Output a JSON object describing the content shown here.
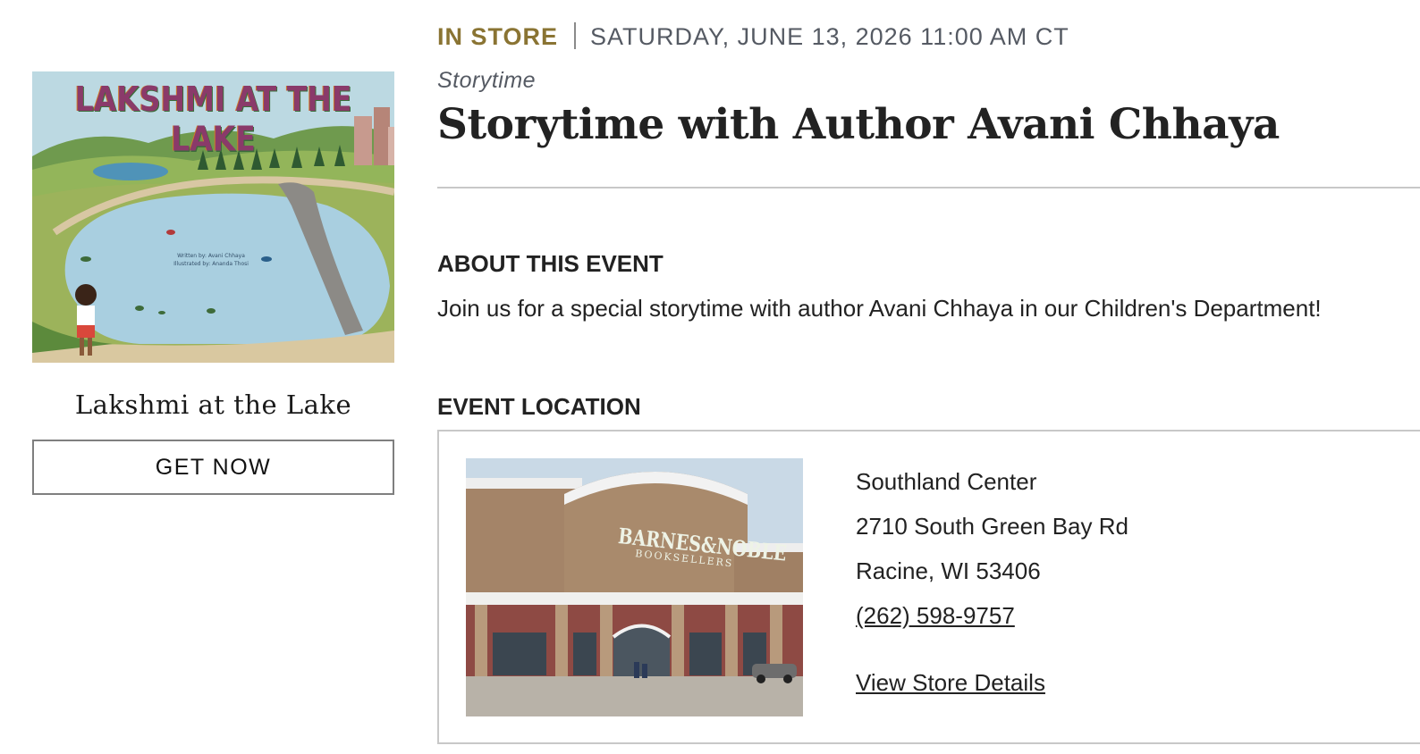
{
  "book": {
    "cover_title": "LAKSHMI AT THE LAKE",
    "cover_credit_author": "Written by: Avani Chhaya",
    "cover_credit_illustrator": "Illustrated by: Ananda Thosi",
    "title": "Lakshmi at the Lake",
    "cta_label": "GET NOW"
  },
  "event": {
    "type": "IN STORE",
    "datetime": "SATURDAY, JUNE 13, 2026 11:00 AM CT",
    "category": "Storytime",
    "title": "Storytime with Author Avani Chhaya",
    "about_heading": "ABOUT THIS EVENT",
    "about_text": "Join us for a special storytime with author Avani Chhaya in our Children's Department!",
    "location_heading": "EVENT LOCATION"
  },
  "location": {
    "photo_sign_line1": "BARNES&NOBLE",
    "photo_sign_line2": "BOOKSELLERS",
    "store_name": "Southland Center",
    "address_line1": "2710 South Green Bay Rd",
    "address_line2": "Racine, WI 53406",
    "phone": "(262) 598-9757",
    "details_link": "View Store Details"
  },
  "colors": {
    "accent_gold": "#8a7433",
    "meta_gray": "#555a63",
    "divider": "#c8c8c8",
    "text": "#222222"
  }
}
